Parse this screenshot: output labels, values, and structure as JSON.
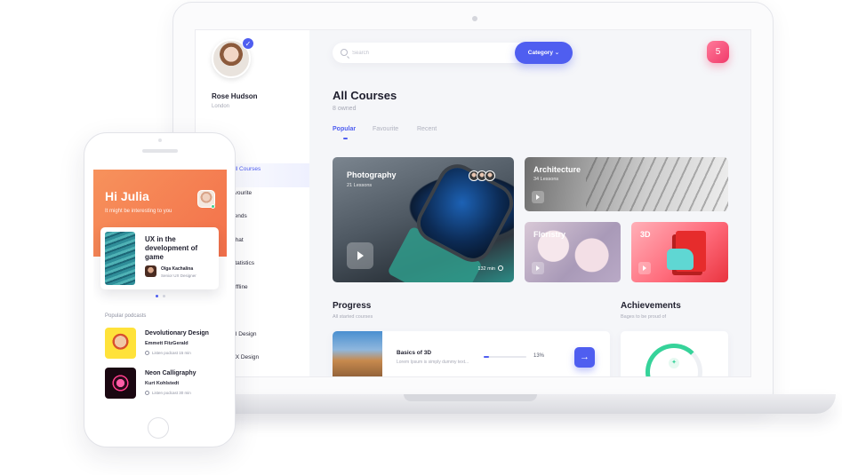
{
  "laptop": {
    "profile": {
      "name": "Rose Hudson",
      "location": "London"
    },
    "sidebar": {
      "items": [
        {
          "label": "All Courses",
          "active": true
        },
        {
          "label": "avourite"
        },
        {
          "label": "riends"
        },
        {
          "label": "Chat"
        },
        {
          "label": "Statistics"
        },
        {
          "label": "Offline"
        },
        {
          "label": ""
        },
        {
          "label": "UI Design"
        },
        {
          "label": "UX Design"
        }
      ]
    },
    "search": {
      "placeholder": "Search"
    },
    "category_label": "Category",
    "notification_count": "5",
    "page_title": "All Courses",
    "page_subtitle": "8 owned",
    "tabs": [
      {
        "label": "Popular",
        "active": true
      },
      {
        "label": "Favourite"
      },
      {
        "label": "Recent"
      }
    ],
    "courses": [
      {
        "title": "Photography",
        "lessons": "21 Lessons",
        "duration": "132 min"
      },
      {
        "title": "Architecture",
        "lessons": "34 Lessons"
      },
      {
        "title": "Floristry"
      },
      {
        "title": "3D"
      }
    ],
    "progress": {
      "title": "Progress",
      "subtitle": "All started courses",
      "course": "Basics of 3D",
      "description": "Lorem Ipsum is simply dummy text...",
      "percent_label": "13%",
      "percent_value": 0.13
    },
    "achievements": {
      "title": "Achievements",
      "subtitle": "Bages to be proud of"
    }
  },
  "phone": {
    "greeting": "Hi Julia",
    "greeting_sub": "It might be interesting to you",
    "featured": {
      "title": "UX in the development of game",
      "author": "Olga Kachalina",
      "role": "Senior UX Designer"
    },
    "podcasts_label": "Popular podcasts",
    "podcasts": [
      {
        "title": "Devolutionary Design",
        "author": "Emmett FitzGerald",
        "meta": "Listen podcast 15 min"
      },
      {
        "title": "Neon Calligraphy",
        "author": "Kurt Kohlstedt",
        "meta": "Listen podcast 30 min"
      }
    ]
  },
  "colors": {
    "accent": "#4f5ef0",
    "phone_header": "#f3704a",
    "notification": "#f03a6a",
    "achievement": "#36d39a"
  }
}
